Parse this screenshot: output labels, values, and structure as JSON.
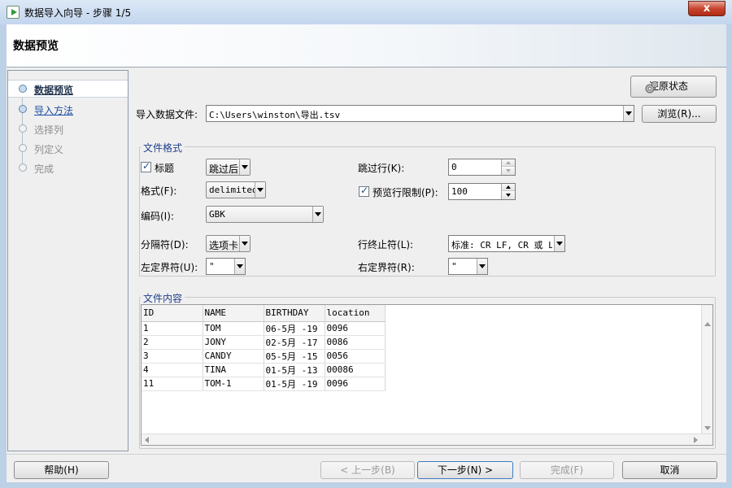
{
  "window": {
    "title": "数据导入向导 - 步骤 1/5",
    "close_glyph": "x"
  },
  "header": {
    "title": "数据预览"
  },
  "steps": [
    {
      "label": "数据预览",
      "state": "current"
    },
    {
      "label": "导入方法",
      "state": "done"
    },
    {
      "label": "选择列",
      "state": "pending"
    },
    {
      "label": "列定义",
      "state": "pending"
    },
    {
      "label": "完成",
      "state": "pending"
    }
  ],
  "restore_button": {
    "label": "还原状态",
    "icon": "gears-icon"
  },
  "file": {
    "label": "导入数据文件:",
    "value": "C:\\Users\\winston\\导出.tsv",
    "browse_label": "浏览(R)..."
  },
  "file_format": {
    "title": "文件格式",
    "header_label": "标题",
    "header_checked": true,
    "header_option": "跳过后",
    "skip_rows_label": "跳过行(K):",
    "skip_rows_value": "0",
    "format_label": "格式(F):",
    "format_value": "delimited",
    "preview_limit_label": "预览行限制(P):",
    "preview_limit_checked": true,
    "preview_limit_value": "100",
    "encoding_label": "编码(I):",
    "encoding_value": "GBK",
    "delimiter_label": "分隔符(D):",
    "delimiter_value": "选项卡",
    "line_terminator_label": "行终止符(L):",
    "line_terminator_value": "标准: CR LF, CR 或 LF",
    "left_enclosure_label": "左定界符(U):",
    "left_enclosure_value": "\"",
    "right_enclosure_label": "右定界符(R):",
    "right_enclosure_value": "\""
  },
  "file_content": {
    "title": "文件内容",
    "columns": [
      "ID",
      "NAME",
      "BIRTHDAY",
      "location"
    ],
    "rows": [
      [
        "1",
        "TOM",
        "06-5月 -19",
        "0096"
      ],
      [
        "2",
        "JONY",
        "02-5月 -17",
        "0086"
      ],
      [
        "3",
        "CANDY",
        "05-5月 -15",
        "0056"
      ],
      [
        "4",
        "TINA",
        "01-5月 -13",
        "00086"
      ],
      [
        "11",
        "TOM-1",
        "01-5月 -19",
        "0096"
      ]
    ]
  },
  "footer": {
    "help": "帮助(H)",
    "back": "< 上一步(B)",
    "next": "下一步(N) >",
    "finish": "完成(F)",
    "cancel": "取消"
  }
}
